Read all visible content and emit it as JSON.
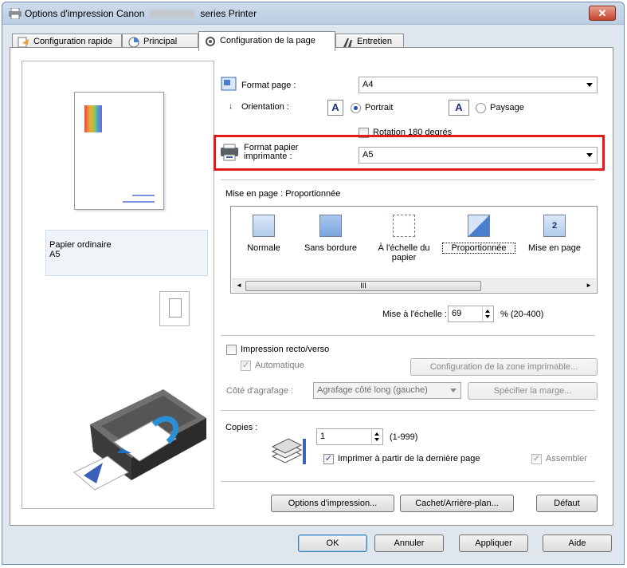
{
  "window": {
    "title_left": "Options d'impression Canon",
    "title_right": "series Printer",
    "close_label": "✕"
  },
  "tabs": [
    {
      "label": "Configuration rapide"
    },
    {
      "label": "Principal"
    },
    {
      "label": "Configuration de la page"
    },
    {
      "label": "Entretien"
    }
  ],
  "preview": {
    "media_type": "Papier ordinaire",
    "paper_size": "A5"
  },
  "page_setup": {
    "format_page_label": "Format page :",
    "format_page_value": "A4",
    "orientation_label": "Orientation :",
    "portrait_label": "Portrait",
    "paysage_label": "Paysage",
    "rotation_label": "Rotation 180 degrés",
    "format_papier_label_1": "Format papier",
    "format_papier_label_2": "imprimante :",
    "format_papier_value": "A5"
  },
  "layout": {
    "label": "Mise en page : Proportionnée",
    "items": [
      {
        "line1": "Normale",
        "line2": ""
      },
      {
        "line1": "Sans bordure",
        "line2": ""
      },
      {
        "line1": "À l'échelle du",
        "line2": "papier"
      },
      {
        "line1": "Proportionnée",
        "line2": ""
      },
      {
        "line1": "Mise en page",
        "line2": ""
      }
    ],
    "scroll_grip": "III",
    "scale_label": "Mise à l'échelle :",
    "scale_value": "69",
    "scale_range": "% (20-400)"
  },
  "duplex": {
    "label": "Impression recto/verso",
    "auto_label": "Automatique",
    "config_button": "Configuration de la zone imprimable...",
    "staple_label": "Côté d'agrafage :",
    "staple_value": "Agrafage côté long (gauche)",
    "margin_button": "Spécifier la marge..."
  },
  "copies": {
    "label": "Copies :",
    "value": "1",
    "range": "(1-999)",
    "last_page_label": "Imprimer à partir de la dernière page",
    "collate_label": "Assembler"
  },
  "buttons": {
    "options": "Options d'impression...",
    "cachet": "Cachet/Arrière-plan...",
    "defaut": "Défaut",
    "ok": "OK",
    "annuler": "Annuler",
    "appliquer": "Appliquer",
    "aide": "Aide"
  },
  "colors": {
    "highlight": "#e41b1b",
    "titlebar": "#b9cde2",
    "close": "#c4432b"
  }
}
